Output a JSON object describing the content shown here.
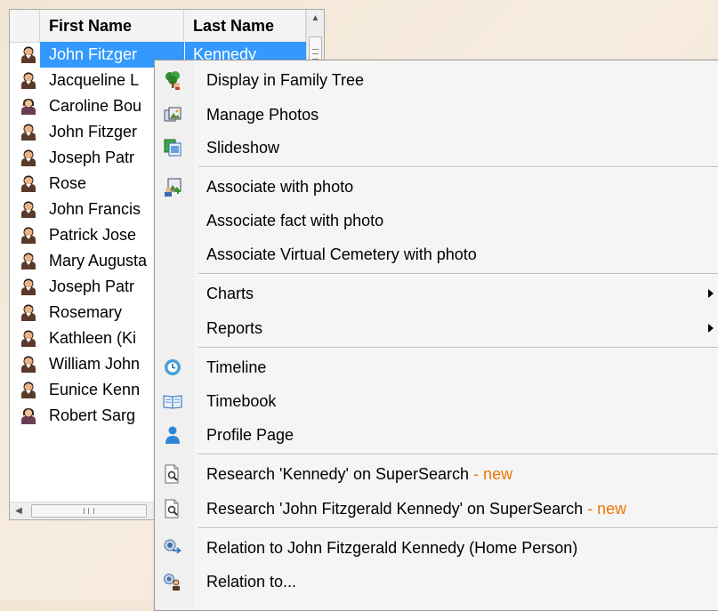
{
  "grid": {
    "columns": {
      "first": "First Name",
      "last": "Last Name"
    },
    "rows": [
      {
        "first": "John Fitzger",
        "last": "Kennedy",
        "icon": "person-icon",
        "selected": true
      },
      {
        "first": "Jacqueline L",
        "last": "",
        "icon": "person-icon"
      },
      {
        "first": "Caroline Bou",
        "last": "",
        "icon": "person-female-icon"
      },
      {
        "first": "John Fitzger",
        "last": "",
        "icon": "person-icon"
      },
      {
        "first": "Joseph Patr",
        "last": "",
        "icon": "person-icon"
      },
      {
        "first": "Rose",
        "last": "",
        "icon": "person-icon"
      },
      {
        "first": "John Francis",
        "last": "",
        "icon": "person-icon"
      },
      {
        "first": "Patrick Jose",
        "last": "",
        "icon": "person-icon"
      },
      {
        "first": "Mary Augusta",
        "last": "",
        "icon": "person-icon"
      },
      {
        "first": "Joseph Patr",
        "last": "",
        "icon": "person-icon"
      },
      {
        "first": "Rosemary",
        "last": "",
        "icon": "person-icon"
      },
      {
        "first": "Kathleen (Ki",
        "last": "",
        "icon": "person-icon"
      },
      {
        "first": "William John",
        "last": "",
        "icon": "person-icon"
      },
      {
        "first": "Eunice Kenn",
        "last": "",
        "icon": "person-icon"
      },
      {
        "first": "Robert Sarg",
        "last": "",
        "icon": "person-female-icon"
      }
    ],
    "scroll_left_glyph": "◀",
    "scroll_up_glyph": "▲"
  },
  "menu": {
    "items": [
      {
        "label": "Display in Family Tree",
        "icon": "family-tree-icon"
      },
      {
        "label": "Manage Photos",
        "icon": "photos-icon"
      },
      {
        "label": "Slideshow",
        "icon": "slideshow-icon"
      },
      {
        "label": "Associate with photo",
        "icon": "associate-photo-icon"
      },
      {
        "label": "Associate fact with photo",
        "icon": ""
      },
      {
        "label": "Associate Virtual Cemetery with photo",
        "icon": ""
      },
      {
        "label": "Charts",
        "icon": "",
        "submenu": true
      },
      {
        "label": "Reports",
        "icon": "",
        "submenu": true
      },
      {
        "label": "Timeline",
        "icon": "timeline-icon"
      },
      {
        "label": "Timebook",
        "icon": "timebook-icon"
      },
      {
        "label": "Profile Page",
        "icon": "profile-icon"
      },
      {
        "label": "Research 'Kennedy' on SuperSearch",
        "new_tag": " - new",
        "icon": "research-icon"
      },
      {
        "label": "Research 'John Fitzgerald Kennedy' on SuperSearch",
        "new_tag": " - new",
        "icon": "research-icon"
      },
      {
        "label": "Relation to John Fitzgerald Kennedy (Home Person)",
        "icon": "relation-icon"
      },
      {
        "label": "Relation to...",
        "icon": "relation-people-icon"
      }
    ]
  },
  "colors": {
    "selection": "#3399ff",
    "new_tag": "#ee7700"
  }
}
